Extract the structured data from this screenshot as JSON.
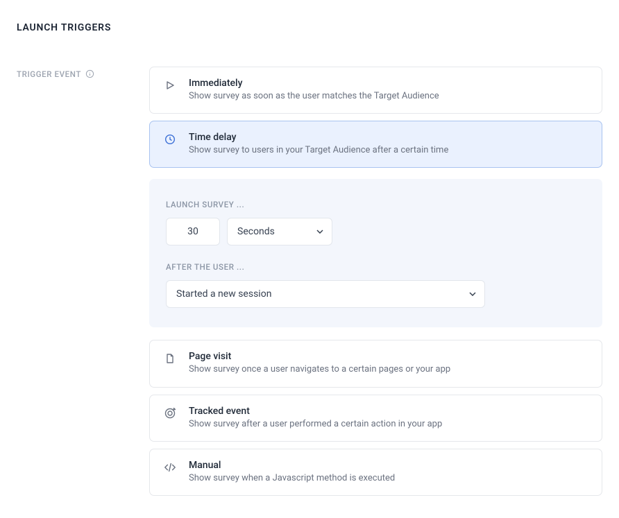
{
  "section_title": "LAUNCH TRIGGERS",
  "sidebar_label": "TRIGGER EVENT",
  "options": {
    "immediately": {
      "title": "Immediately",
      "desc": "Show survey as soon as the user matches the Target Audience"
    },
    "time_delay": {
      "title": "Time delay",
      "desc": "Show survey to users in your Target Audience after a certain time"
    },
    "page_visit": {
      "title": "Page visit",
      "desc": "Show survey once a user navigates to a certain pages or your app"
    },
    "tracked_event": {
      "title": "Tracked event",
      "desc": "Show survey after a user performed a certain action in your app"
    },
    "manual": {
      "title": "Manual",
      "desc": "Show survey when a Javascript method is executed"
    }
  },
  "config": {
    "launch_label": "LAUNCH SURVEY ...",
    "delay_value": "30",
    "unit_selected": "Seconds",
    "after_label": "AFTER THE USER ...",
    "after_selected": "Started a new session"
  }
}
